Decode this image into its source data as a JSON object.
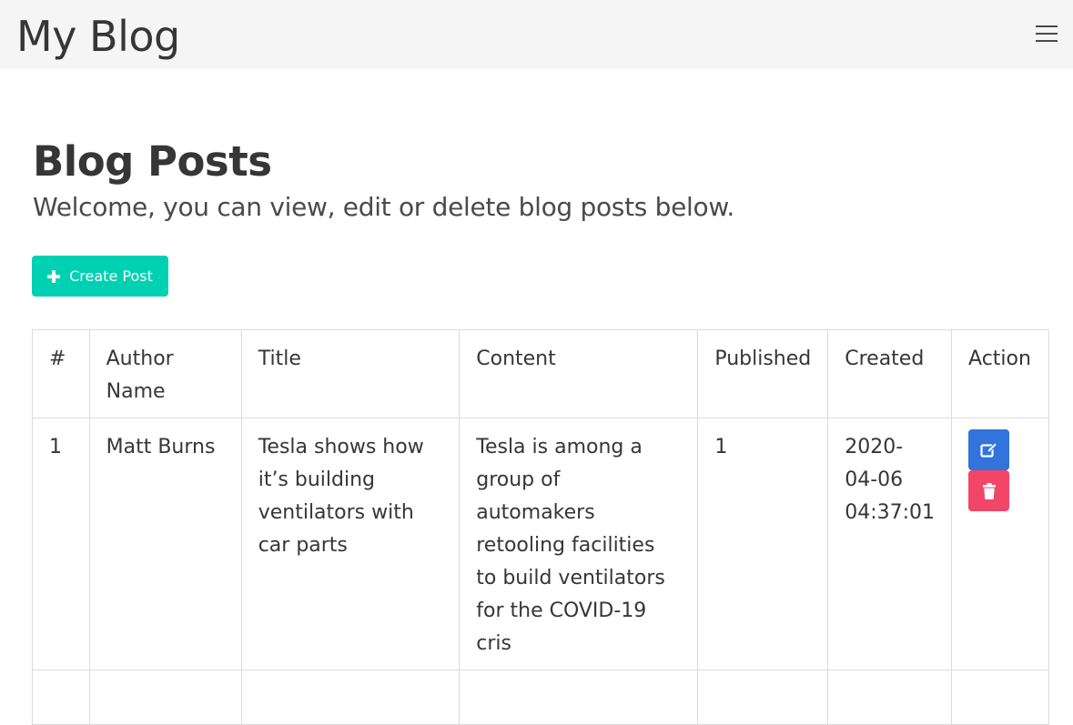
{
  "navbar": {
    "brand": "My Blog",
    "menu_icon": "hamburger-menu-icon"
  },
  "header": {
    "title": "Blog Posts",
    "subtitle": "Welcome, you can view, edit or delete blog posts below."
  },
  "toolbar": {
    "create_label": "Create Post",
    "create_icon": "plus-icon"
  },
  "table": {
    "columns": [
      "#",
      "Author Name",
      "Title",
      "Content",
      "Published",
      "Created",
      "Action"
    ],
    "rows": [
      {
        "id": "1",
        "author": "Matt Burns",
        "title": "Tesla shows how it’s building ventilators with car parts",
        "content": "Tesla is among a group of automakers retooling facilities to build ventilators for the COVID-19 cris",
        "published": "1",
        "created": "2020-04-06 04:37:01",
        "actions": [
          "edit-icon",
          "trash-icon"
        ]
      }
    ]
  },
  "colors": {
    "navbar_bg": "#f5f5f5",
    "primary": "#00d1b2",
    "edit": "#3273dc",
    "delete": "#f14668"
  }
}
